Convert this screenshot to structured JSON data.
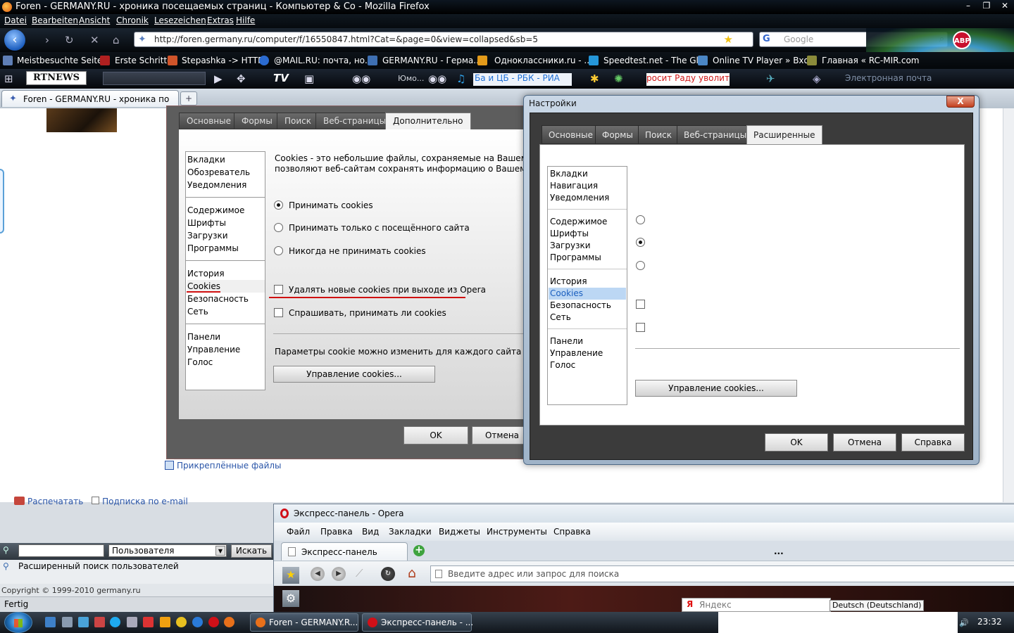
{
  "firefox": {
    "title": "Foren - GERMANY.RU - хроника посещаемых страниц - Компьютер & Co - Mozilla Firefox",
    "menu": [
      "Datei",
      "Bearbeiten",
      "Ansicht",
      "Chronik",
      "Lesezeichen",
      "Extras",
      "Hilfe"
    ],
    "url": "http://foren.germany.ru/computer/f/16550847.html?Cat=&page=0&view=collapsed&sb=5",
    "search_brand": "G",
    "search_placeholder": "Google",
    "abp": "ABP",
    "bookmarks": [
      "Meistbesuchte Seiten",
      "Erste Schritte",
      "Stepashka -> HTTP",
      "@MAIL.RU: почта, но...",
      "GERMANY.RU - Герма...",
      "Одноклассники.ru - ...",
      "Speedtest.net - The Gl...",
      "Online TV Player » Вхо...",
      "Главная « RC-MIR.com"
    ],
    "rtnews": "RTNEWS",
    "tb2_small": "Юмо...",
    "ticker": "Ба и ЦБ - РБК - РИА",
    "ticker2": "росит Раду уволить м",
    "ticker3": "Электронная почта",
    "tab_title": "Foren - GERMANY.RU - хроника по",
    "newtab": "+"
  },
  "screenshot_dialog": {
    "tabs": [
      "Основные",
      "Формы",
      "Поиск",
      "Веб-страницы",
      "Дополнительно"
    ],
    "list_groups": [
      [
        "Вкладки",
        "Обозреватель",
        "Уведомления"
      ],
      [
        "Содержимое",
        "Шрифты",
        "Загрузки",
        "Программы"
      ],
      [
        "История",
        "Cookies",
        "Безопасность",
        "Сеть"
      ],
      [
        "Панели",
        "Управление",
        "Голос"
      ]
    ],
    "description": "Cookies - это небольшие файлы, сохраняемые на Вашем компь",
    "description2": "позволяют веб-сайтам сохранять информацию о Вашем посеще",
    "radio_accept": "Принимать cookies",
    "radio_visited": "Принимать только с посещённого сайта",
    "radio_never": "Никогда не принимать cookies",
    "chk_delete": "Удалять новые cookies при выходе из Opera",
    "chk_ask": "Спрашивать, принимать ли cookies",
    "per_site": "Параметры cookie можно изменить для каждого сайта",
    "manage_btn": "Управление cookies...",
    "ok": "OK",
    "cancel": "Отмена"
  },
  "page": {
    "attachments": "Прикреплённые файлы",
    "print": "Распечатать",
    "subscribe": "Подписка по e-mail",
    "user_select": "Пользователя",
    "search_btn": "Искать",
    "adv_search": "Расширенный поиск пользователей",
    "copyright": "Copyright © 1999-2010 germany.ru",
    "status": "Fertig"
  },
  "settings_dialog": {
    "title": "Настройки",
    "close": "X",
    "tabs": [
      "Основные",
      "Формы",
      "Поиск",
      "Веб-страницы",
      "Расширенные"
    ],
    "list_groups": [
      [
        "Вкладки",
        "Навигация",
        "Уведомления"
      ],
      [
        "Содержимое",
        "Шрифты",
        "Загрузки",
        "Программы"
      ],
      [
        "История",
        "Cookies",
        "Безопасность",
        "Сеть"
      ],
      [
        "Панели",
        "Управление",
        "Голос"
      ]
    ],
    "selected": "Cookies",
    "manage_btn": "Управление cookies...",
    "ok": "OK",
    "cancel": "Отмена",
    "help": "Справка"
  },
  "opera": {
    "title": "Экспресс-панель - Opera",
    "menu": [
      "Файл",
      "Правка",
      "Вид",
      "Закладки",
      "Виджеты",
      "Инструменты",
      "Справка"
    ],
    "tab": "Экспресс-панель",
    "dots": "...",
    "address_placeholder": "Введите адрес или запрос для поиска"
  },
  "tray": {
    "yandex_logo": "Я",
    "yandex": "Яндекс",
    "lang": "Deutsch (Deutschland)",
    "clock": "23:32"
  },
  "taskbar": {
    "items": [
      "Foren - GERMANY.R...",
      "Экспресс-панель - ..."
    ]
  },
  "colors": {
    "accent_red": "#d01010",
    "selection": "#bcd7f4",
    "link": "#2a55a8"
  }
}
